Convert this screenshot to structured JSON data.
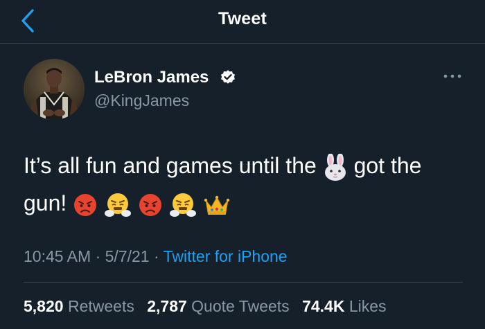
{
  "header": {
    "title": "Tweet",
    "back_icon": "chevron-left-icon"
  },
  "tweet": {
    "author": {
      "display_name": "LeBron James",
      "handle": "@KingJames",
      "verified": true,
      "avatar": "avatar-photo"
    },
    "more_icon": "more-horizontal-icon",
    "text": {
      "part1": "It’s all fun and games until the ",
      "part2": " got the gun! "
    },
    "emojis": [
      "rabbit-face",
      "pouting-face",
      "face-with-steam",
      "pouting-face",
      "face-with-steam",
      "crown"
    ],
    "time": "10:45 AM",
    "separator": " · ",
    "date": "5/7/21",
    "source": "Twitter for iPhone",
    "stats": [
      {
        "count": "5,820",
        "label": "Retweets"
      },
      {
        "count": "2,787",
        "label": "Quote Tweets"
      },
      {
        "count": "74.4K",
        "label": "Likes"
      }
    ]
  },
  "colors": {
    "background": "#15202b",
    "text_primary": "#ffffff",
    "text_secondary": "#8899a6",
    "accent": "#1da1f2",
    "divider": "#38444d"
  }
}
